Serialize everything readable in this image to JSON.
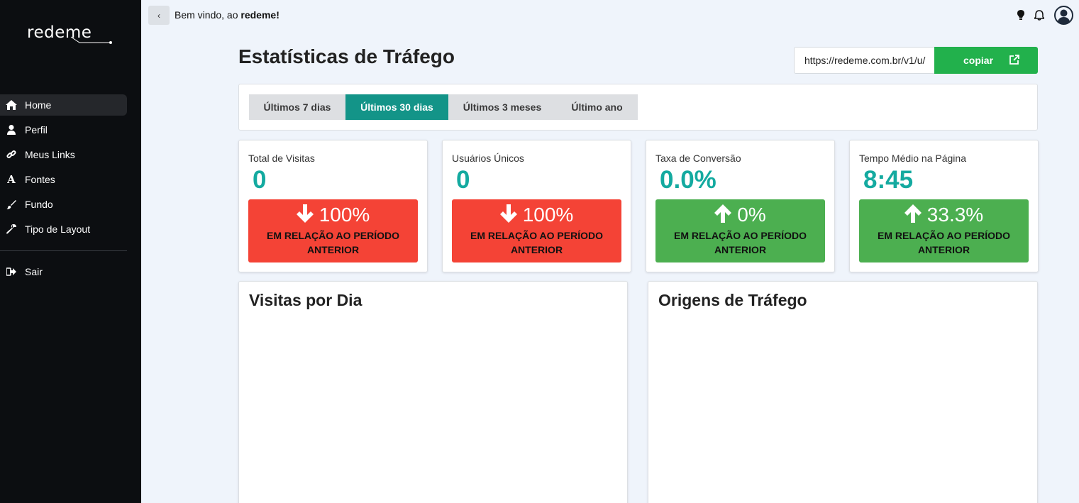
{
  "brand": {
    "logo_text": "redeme"
  },
  "sidebar": {
    "items": [
      {
        "label": "Home",
        "icon": "home-icon",
        "active": true
      },
      {
        "label": "Perfil",
        "icon": "user-icon"
      },
      {
        "label": "Meus Links",
        "icon": "link-icon"
      },
      {
        "label": "Fontes",
        "icon": "font-icon"
      },
      {
        "label": "Fundo",
        "icon": "brush-icon"
      },
      {
        "label": "Tipo de Layout",
        "icon": "wrench-icon"
      }
    ],
    "logout": {
      "label": "Sair",
      "icon": "sign-out-icon"
    }
  },
  "topbar": {
    "back_icon": "chevron-left-icon",
    "welcome_prefix": "Bem vindo, ao ",
    "welcome_name": "redeme!",
    "icons": [
      "lightbulb-icon",
      "bell-icon",
      "user-avatar-icon"
    ]
  },
  "main": {
    "title": "Estatísticas de Tráfego",
    "url_value": "https://redeme.com.br/v1/u/",
    "copy_label": "copiar",
    "copy_icon": "external-link-icon",
    "tabs": [
      {
        "label": "Últimos 7 dias",
        "active": false
      },
      {
        "label": "Últimos 30 dias",
        "active": true
      },
      {
        "label": "Últimos 3 meses",
        "active": false
      },
      {
        "label": "Último ano",
        "active": false
      }
    ],
    "stats": [
      {
        "label": "Total de Visitas",
        "value": "0",
        "direction": "down",
        "change": "100%",
        "caption": "EM RELAÇÃO AO PERÍODO ANTERIOR"
      },
      {
        "label": "Usuários Únicos",
        "value": "0",
        "direction": "down",
        "change": "100%",
        "caption": "EM RELAÇÃO AO PERÍODO ANTERIOR"
      },
      {
        "label": "Taxa de Conversão",
        "value": "0.0%",
        "direction": "up",
        "change": "0%",
        "caption": "EM RELAÇÃO AO PERÍODO ANTERIOR"
      },
      {
        "label": "Tempo Médio na Página",
        "value": "8:45",
        "direction": "up",
        "change": "33.3%",
        "caption": "EM RELAÇÃO AO PERÍODO ANTERIOR"
      }
    ],
    "charts": [
      {
        "title": "Visitas por Dia"
      },
      {
        "title": "Origens de Tráfego"
      }
    ]
  },
  "colors": {
    "sidebar_bg": "#0c0e11",
    "accent_teal": "#139488",
    "value_teal": "#14aaa0",
    "copy_green": "#22b14c",
    "down_red": "#f44336",
    "up_green": "#4caf50"
  }
}
